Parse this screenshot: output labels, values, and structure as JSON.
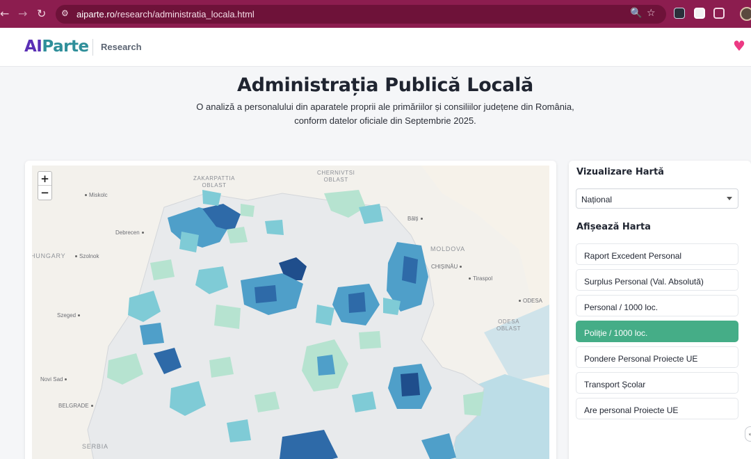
{
  "browser": {
    "back_icon": "←",
    "forward_icon": "→",
    "reload_icon": "↻",
    "tune_icon": "⚙",
    "url_host": "aiparte.ro",
    "url_path": "/research/administratia_locala.html",
    "zoom_icon": "🔍",
    "star_icon": "☆"
  },
  "header": {
    "logo_ai": "AI",
    "logo_parte": "Parte",
    "section": "Research",
    "heart_icon": "♥"
  },
  "hero": {
    "title": "Administrația Publică Locală",
    "subtitle": "O analiză a personalului din aparatele proprii ale primăriilor și consiliilor județene din România, conform datelor oficiale din Septembrie 2025."
  },
  "map": {
    "zoom_in": "+",
    "zoom_out": "−",
    "labels": {
      "zakarpattia": "ZAKARPATTIA\nOBLAST",
      "chernivtsi": "CHERNIVTSI\nOBLAST",
      "miskolc": "Miskolc",
      "debrecen": "Debrecen",
      "hungary": "HUNGARY",
      "szolnok": "Szolnok",
      "balti": "Bălți",
      "moldova": "MOLDOVA",
      "chisinau": "CHIȘINĂU",
      "tiraspol": "Tiraspol",
      "odesa": "ODESA",
      "odesa_oblast": "ODESA\nOBLAST",
      "szeged": "Szeged",
      "novi_sad": "Novi Sad",
      "belgrade": "BELGRADE",
      "serbia": "SERBIA"
    },
    "colors": {
      "base": "#f3f1ec",
      "muni_light": "#e9ecef",
      "green_light": "#b6e3d0",
      "teal": "#7fcbd6",
      "blue_mid": "#4f9fc9",
      "blue_dark": "#2e6aa8",
      "navy": "#1f4e8c"
    }
  },
  "sidebar": {
    "viz_heading": "Vizualizare Hartă",
    "viz_select_value": "Național",
    "show_heading": "Afișează Harta",
    "options": [
      "Raport Excedent Personal",
      "Surplus Personal (Val. Absolută)",
      "Personal / 1000 loc.",
      "Poliție / 1000 loc.",
      "Pondere Personal Proiecte UE",
      "Transport Școlar",
      "Are personal Proiecte UE"
    ],
    "active_option": "Poliție / 1000 loc.",
    "scroll_icon": "↙"
  }
}
